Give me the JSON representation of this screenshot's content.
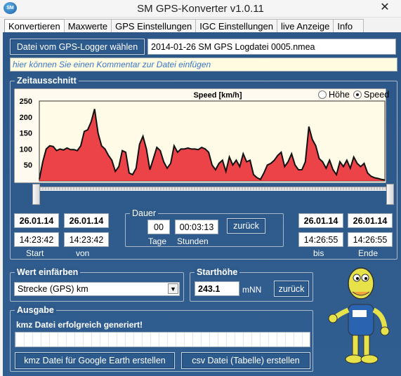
{
  "window": {
    "title": "SM GPS-Konverter v1.0.11",
    "icon_text": "SM"
  },
  "tabs": [
    {
      "label": "Konvertieren",
      "active": true
    },
    {
      "label": "Maxwerte",
      "active": false
    },
    {
      "label": "GPS Einstellungen",
      "active": false
    },
    {
      "label": "IGC Einstellungen",
      "active": false
    },
    {
      "label": "live Anzeige",
      "active": false
    },
    {
      "label": "Info",
      "active": false
    }
  ],
  "file": {
    "button_label": "Datei vom GPS-Logger wählen",
    "filename": "2014-01-26 SM GPS Logdatei 0005.nmea",
    "comment_placeholder": "hier können Sie einen Kommentar zur Datei einfügen"
  },
  "zeitausschnitt": {
    "label": "Zeitausschnitt",
    "radio_hoehe": "Höhe",
    "radio_speed": "Speed",
    "selected": "Speed",
    "start_date": "26.01.14",
    "start_time": "14:23:42",
    "start_label": "Start",
    "von_date": "26.01.14",
    "von_time": "14:23:42",
    "von_label": "von",
    "bis_date": "26.01.14",
    "bis_time": "14:26:55",
    "bis_label": "bis",
    "ende_date": "26.01.14",
    "ende_time": "14:26:55",
    "ende_label": "Ende"
  },
  "dauer": {
    "label": "Dauer",
    "tage_value": "00",
    "stunden_value": "00:03:13",
    "tage_label": "Tage",
    "stunden_label": "Stunden",
    "reset_label": "zurück"
  },
  "wert_einfaerben": {
    "label": "Wert einfärben",
    "selected": "Strecke (GPS) km"
  },
  "starthoehe": {
    "label": "Starthöhe",
    "value": "243.1",
    "unit": "mNN",
    "reset_label": "zurück"
  },
  "ausgabe": {
    "label": "Ausgabe",
    "status": "kmz Datei erfolgreich generiert!",
    "progress": 0,
    "kmz_button": "kmz Datei für Google Earth erstellen",
    "csv_button": "csv Datei (Tabelle) erstellen"
  },
  "colors": {
    "panel": "#2f5a8a",
    "curve_fill": "#e8222a",
    "chart_bg": "#fffbe6"
  },
  "chart_data": {
    "type": "area",
    "title": "Speed [km/h]",
    "ylim": [
      0,
      250
    ],
    "yticks": [
      50,
      100,
      150,
      200,
      250
    ],
    "grid": false,
    "x": [
      0,
      1,
      2,
      3,
      4,
      5,
      6,
      7,
      8,
      9,
      10,
      11,
      12,
      13,
      14,
      15,
      16,
      17,
      18,
      19,
      20,
      21,
      22,
      23,
      24,
      25,
      26,
      27,
      28,
      29,
      30,
      31,
      32,
      33,
      34,
      35,
      36,
      37,
      38,
      39,
      40,
      41,
      42,
      43,
      44,
      45,
      46,
      47,
      48,
      49,
      50,
      51,
      52,
      53,
      54,
      55,
      56,
      57,
      58,
      59,
      60,
      61,
      62,
      63,
      64,
      65,
      66,
      67,
      68,
      69,
      70,
      71,
      72,
      73,
      74,
      75,
      76,
      77,
      78,
      79,
      80,
      81,
      82,
      83,
      84,
      85,
      86,
      87,
      88,
      89,
      90,
      91,
      92,
      93,
      94,
      95,
      96,
      97,
      98,
      99,
      100
    ],
    "values": [
      5,
      60,
      100,
      110,
      108,
      95,
      100,
      97,
      103,
      98,
      98,
      95,
      110,
      155,
      160,
      185,
      225,
      150,
      110,
      100,
      80,
      65,
      30,
      45,
      95,
      90,
      25,
      20,
      40,
      115,
      140,
      100,
      35,
      70,
      105,
      95,
      60,
      40,
      55,
      110,
      90,
      100,
      100,
      103,
      100,
      100,
      98,
      105,
      100,
      90,
      50,
      35,
      55,
      65,
      30,
      75,
      50,
      65,
      45,
      85,
      60,
      65,
      20,
      10,
      5,
      25,
      50,
      55,
      65,
      80,
      90,
      45,
      60,
      85,
      50,
      35,
      35,
      60,
      170,
      130,
      110,
      70,
      60,
      40,
      65,
      35,
      20,
      60,
      45,
      65,
      40,
      75,
      55,
      45,
      55,
      25,
      15,
      10,
      8,
      5,
      3
    ]
  }
}
